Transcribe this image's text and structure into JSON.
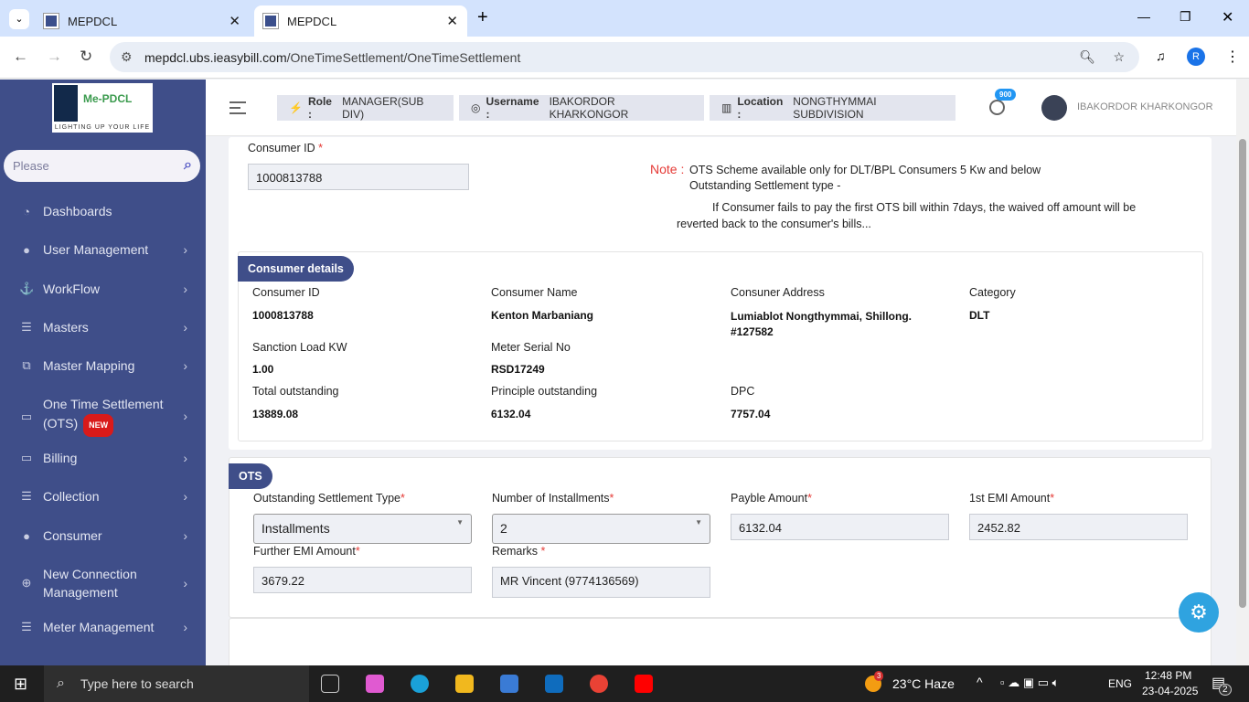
{
  "browser": {
    "tabs": [
      {
        "title": "MEPDCL"
      },
      {
        "title": "MEPDCL"
      }
    ],
    "url_host": "mepdcl.ubs.ieasybill.com",
    "url_path": "/OneTimeSettlement/OneTimeSettlement",
    "profile_initial": "R"
  },
  "sidebar": {
    "logo_text": "Me-PDCL",
    "logo_tagline": "LIGHTING UP YOUR LIFE",
    "search_placeholder": "Please",
    "new_badge": "NEW",
    "items": [
      {
        "label": "Dashboards",
        "icon": "gauge-icon"
      },
      {
        "label": "User Management",
        "icon": "user-icon"
      },
      {
        "label": "WorkFlow",
        "icon": "anchor-icon"
      },
      {
        "label": "Masters",
        "icon": "list-icon"
      },
      {
        "label": "Master Mapping",
        "icon": "sitemap-icon"
      },
      {
        "label": "One Time Settlement (OTS)",
        "icon": "monitor-icon"
      },
      {
        "label": "Billing",
        "icon": "monitor-icon"
      },
      {
        "label": "Collection",
        "icon": "list-icon"
      },
      {
        "label": "Consumer",
        "icon": "user-icon"
      },
      {
        "label": "New Connection Management",
        "icon": "plus-circle-icon"
      },
      {
        "label": "Meter Management",
        "icon": "list-icon"
      }
    ]
  },
  "topbar": {
    "role_label": "Role :",
    "role": "MANAGER(SUB DIV)",
    "username_label": "Username :",
    "username": "IBAKORDOR KHARKONGOR",
    "location_label": "Location :",
    "location": "NONGTHYMMAI SUBDIVISION",
    "notif_count": "900",
    "user_display": "IBAKORDOR KHARKONGOR"
  },
  "form": {
    "consumer_id_label": "Consumer ID",
    "consumer_id": "1000813788",
    "note_label": "Note :",
    "note_line1": "OTS Scheme available only for DLT/BPL Consumers 5 Kw and below",
    "note_line2": "Outstanding Settlement type -",
    "note_line3": "If Consumer fails to pay the first OTS bill within 7days, the waived off amount will be",
    "note_line4": "reverted back to the consumer's bills..."
  },
  "details": {
    "title": "Consumer details",
    "fields": [
      {
        "label": "Consumer ID",
        "value": "1000813788"
      },
      {
        "label": "Consumer Name",
        "value": "Kenton Marbaniang"
      },
      {
        "label": "Consuner Address",
        "value": "Lumiablot Nongthymmai, Shillong. #127582"
      },
      {
        "label": "Category",
        "value": "DLT"
      },
      {
        "label": "Sanction Load KW",
        "value": "1.00"
      },
      {
        "label": "Meter Serial No",
        "value": "RSD17249"
      },
      {
        "label": "Total outstanding",
        "value": "13889.08"
      },
      {
        "label": "Principle outstanding",
        "value": "6132.04"
      },
      {
        "label": "DPC",
        "value": "7757.04"
      }
    ]
  },
  "ots": {
    "title": "OTS",
    "settlement_type_label": "Outstanding Settlement Type",
    "settlement_type": "Installments",
    "installments_label": "Number of Installments",
    "installments": "2",
    "payable_label": "Payble Amount",
    "payable": "6132.04",
    "first_emi_label": "1st EMI Amount",
    "first_emi": "2452.82",
    "further_emi_label": "Further EMI Amount",
    "further_emi": "3679.22",
    "remarks_label": "Remarks",
    "remarks": "MR Vincent (9774136569)"
  },
  "taskbar": {
    "search_placeholder": "Type here to search",
    "weather": "23°C  Haze",
    "weather_badge": "3",
    "lang": "ENG",
    "time": "12:48 PM",
    "date": "23-04-2025",
    "notif_count": "2"
  }
}
